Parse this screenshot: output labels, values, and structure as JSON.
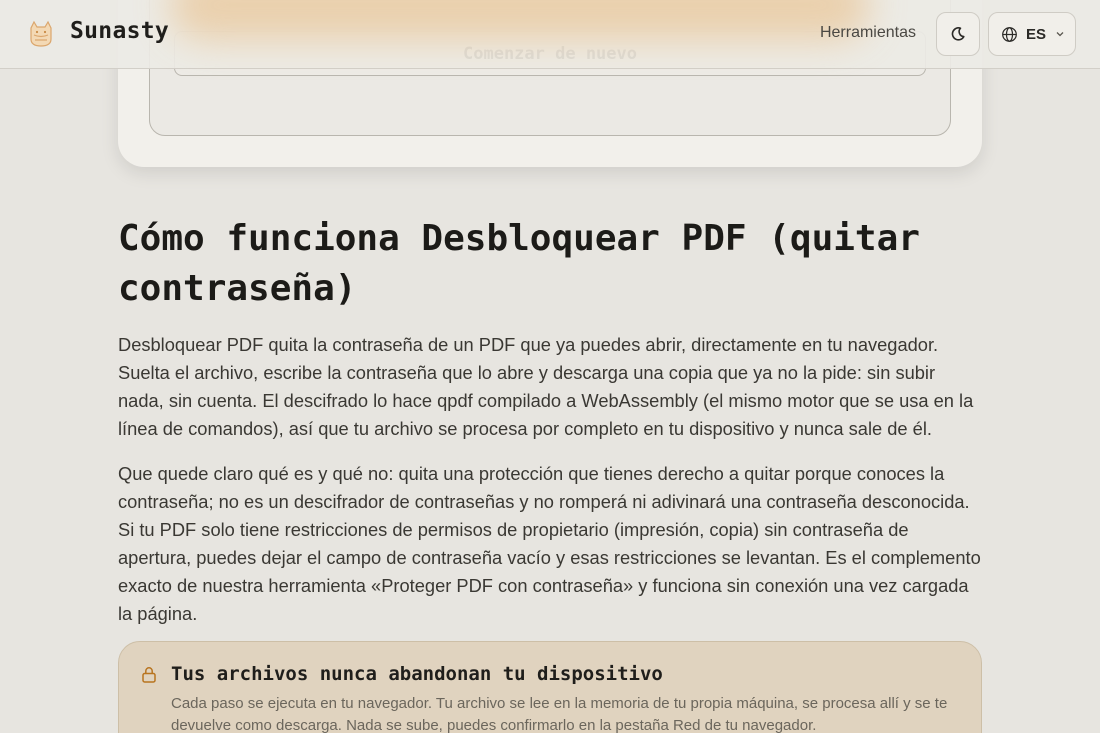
{
  "header": {
    "brand": "Sunasty",
    "nav_tools": "Herramientas",
    "language_code": "ES",
    "logo_icon": "cat-logo-icon",
    "theme_icon": "moon-icon",
    "globe_icon": "globe-icon",
    "chevron_icon": "chevron-down-icon"
  },
  "card": {
    "restart_label": "Comenzar de nuevo"
  },
  "content": {
    "title": "Cómo funciona Desbloquear PDF (quitar contraseña)",
    "paragraph_1": "Desbloquear PDF quita la contraseña de un PDF que ya puedes abrir, directamente en tu navegador. Suelta el archivo, escribe la contraseña que lo abre y descarga una copia que ya no la pide: sin subir nada, sin cuenta. El descifrado lo hace qpdf compilado a WebAssembly (el mismo motor que se usa en la línea de comandos), así que tu archivo se procesa por completo en tu dispositivo y nunca sale de él.",
    "paragraph_2": "Que quede claro qué es y qué no: quita una protección que tienes derecho a quitar porque conoces la contraseña; no es un descifrador de contraseñas y no romperá ni adivinará una contraseña desconocida. Si tu PDF solo tiene restricciones de permisos de propietario (impresión, copia) sin contraseña de apertura, puedes dejar el campo de contraseña vacío y esas restricciones se levantan. Es el complemento exacto de nuestra herramienta «Proteger PDF con contraseña» y funciona sin conexión una vez cargada la página."
  },
  "notice": {
    "icon": "lock-icon",
    "title": "Tus archivos nunca abandonan tu dispositivo",
    "body": "Cada paso se ejecuta en tu navegador. Tu archivo se lee en la memoria de tu propia máquina, se procesa allí y se te devuelve como descarga. Nada se sube, puedes confirmarlo en la pestaña Red de tu navegador."
  },
  "colors": {
    "background": "#e7e5e0",
    "notice_background": "#e0d3bf",
    "accent_glow": "#eac79a",
    "lock_icon": "#b8741f"
  }
}
